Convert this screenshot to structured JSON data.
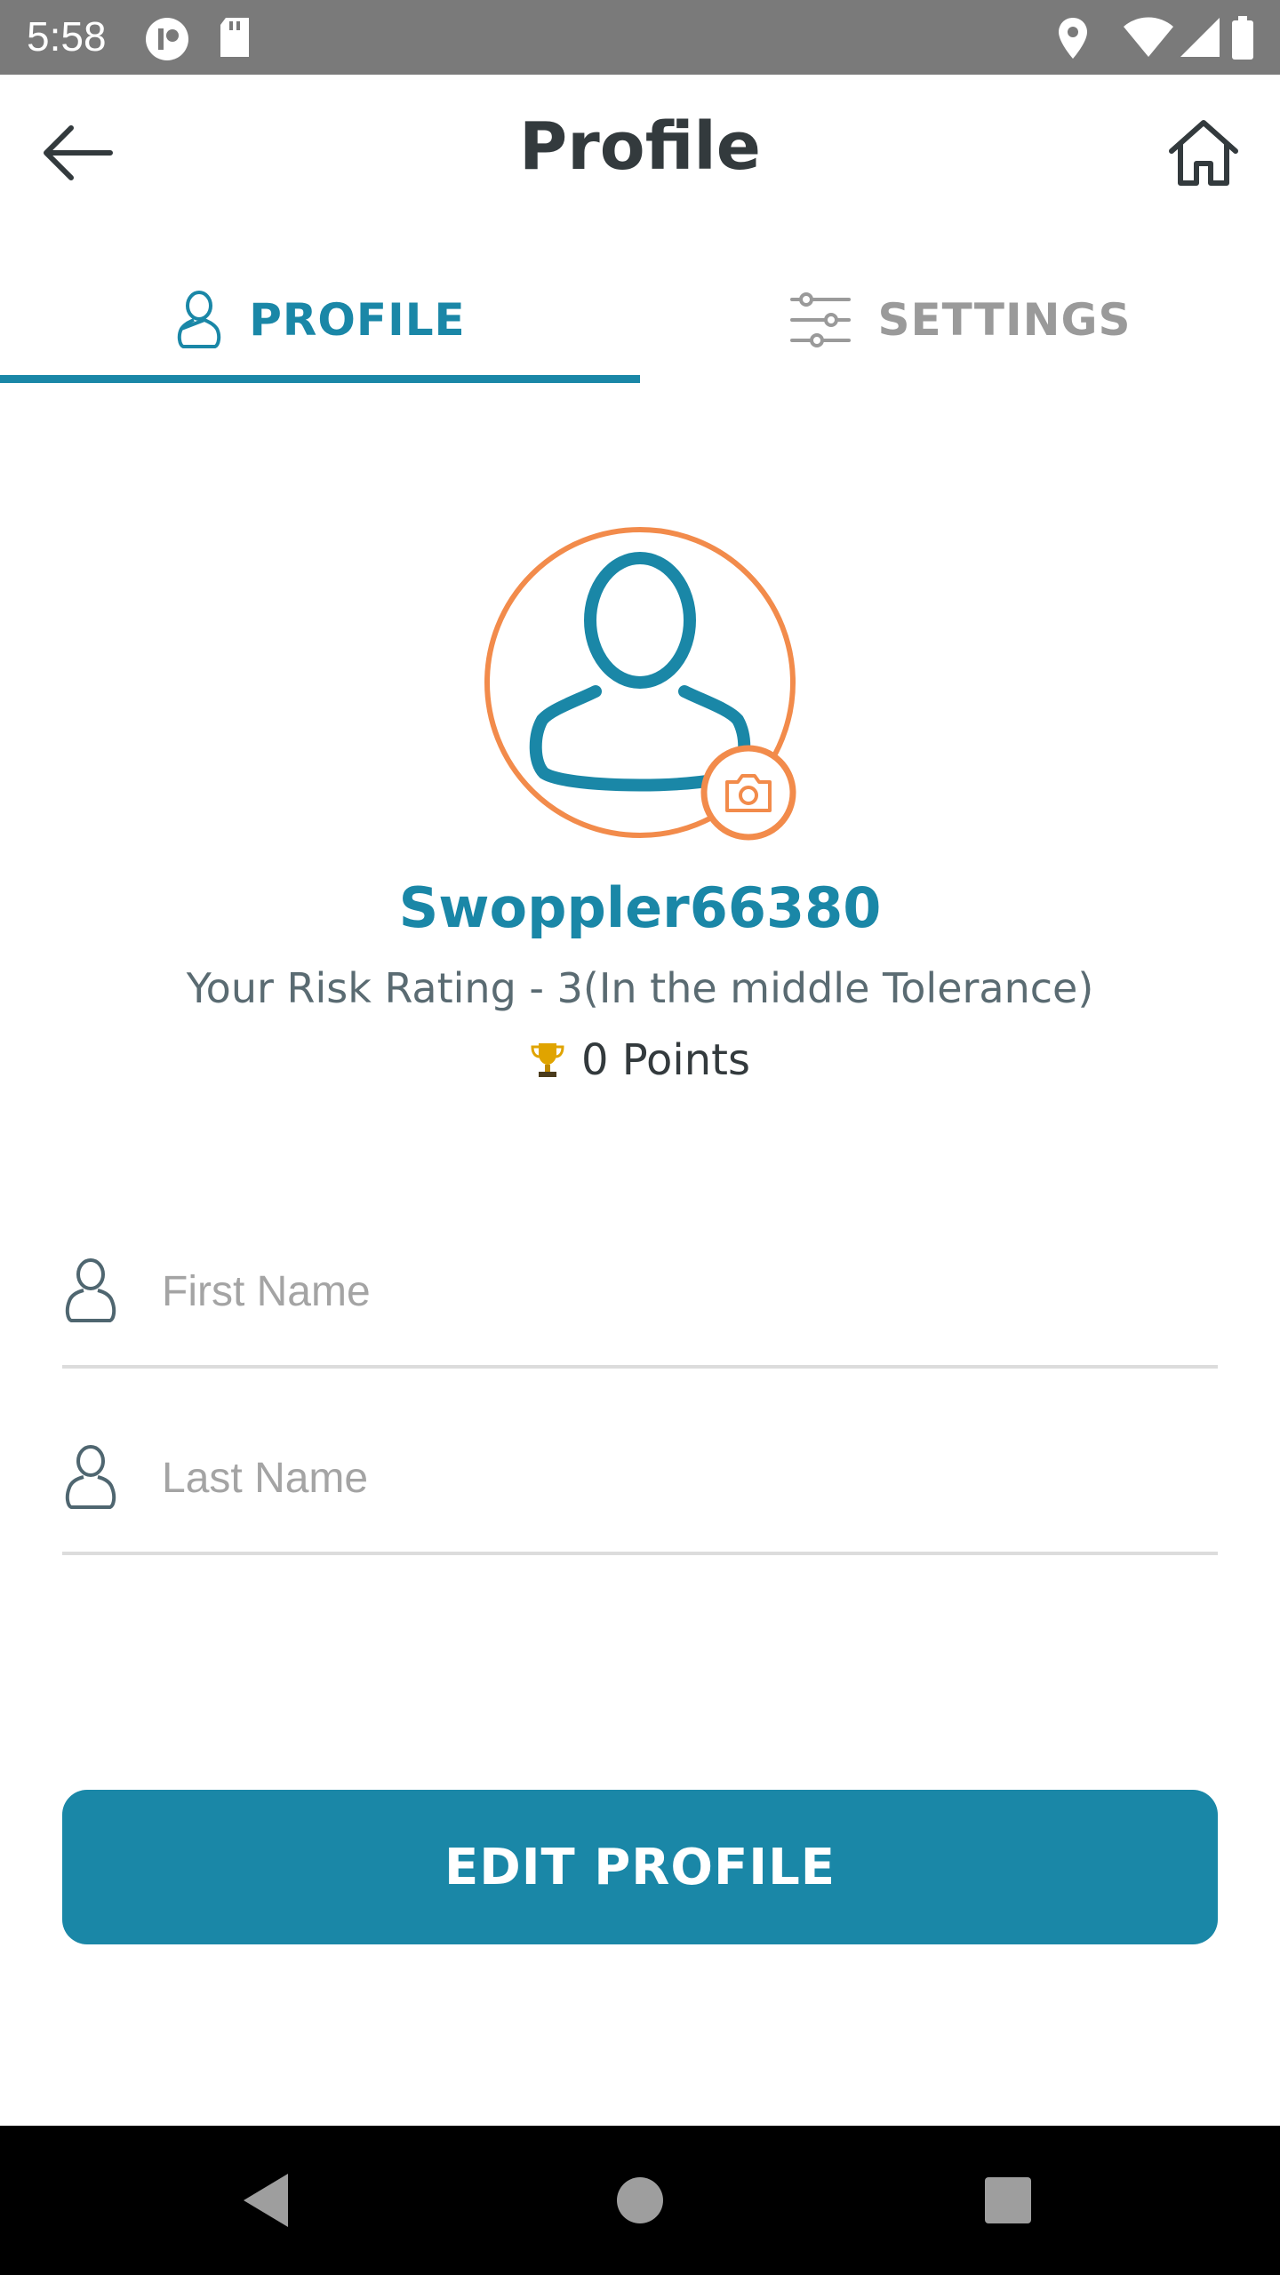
{
  "status_bar": {
    "time": "5:58"
  },
  "header": {
    "title": "Profile",
    "back_icon": "arrow-left-icon",
    "home_icon": "home-icon"
  },
  "tabs": [
    {
      "label": "PROFILE",
      "icon": "user-outline-icon",
      "selected": true
    },
    {
      "label": "SETTINGS",
      "icon": "sliders-icon",
      "selected": false
    }
  ],
  "profile": {
    "username": "Swoppler66380",
    "risk_rating": "Your Risk Rating - 3(In the middle Tolerance)",
    "points": "0 Points",
    "points_icon": "trophy-icon",
    "camera_icon": "camera-icon"
  },
  "form": {
    "first_name_placeholder": "First Name",
    "last_name_placeholder": "Last Name"
  },
  "actions": {
    "edit_label": "EDIT PROFILE"
  },
  "colors": {
    "accent": "#1a87a7",
    "avatar_ring": "#f28b4b",
    "status_bar": "#7a7a7a"
  }
}
